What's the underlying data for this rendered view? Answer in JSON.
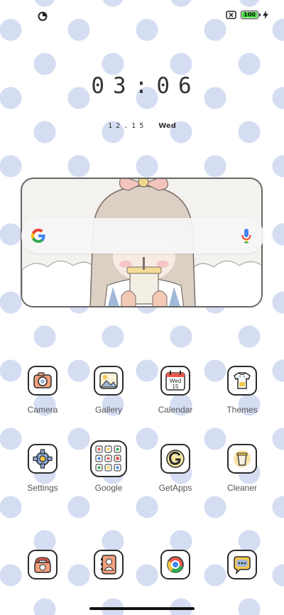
{
  "status_bar": {
    "left_icon": "data-saver-icon",
    "battery_percent": 100,
    "battery_label": "100",
    "battery_color": "#3fdc3a",
    "icons": [
      "no-sim-icon",
      "battery-icon",
      "charging-bolt-icon"
    ]
  },
  "clock": {
    "time": "03:06",
    "date_numeric": "12.15",
    "weekday": "Wed"
  },
  "search_widget": {
    "icons": [
      "google-logo-icon",
      "mic-icon"
    ]
  },
  "apps": [
    {
      "label": "Camera",
      "icon": "camera-icon"
    },
    {
      "label": "Gallery",
      "icon": "gallery-icon"
    },
    {
      "label": "Calendar",
      "icon": "calendar-icon",
      "icon_text_top": "Wed",
      "icon_text_bottom": "15"
    },
    {
      "label": "Themes",
      "icon": "themes-icon"
    },
    {
      "label": "Settings",
      "icon": "gear-icon"
    },
    {
      "label": "Google",
      "icon": "google-folder-icon"
    },
    {
      "label": "GetApps",
      "icon": "getapps-icon"
    },
    {
      "label": "Cleaner",
      "icon": "cleaner-icon"
    }
  ],
  "dock": [
    {
      "icon": "phone-icon"
    },
    {
      "icon": "contacts-icon"
    },
    {
      "icon": "chrome-icon"
    },
    {
      "icon": "messages-icon"
    }
  ],
  "colors": {
    "background": "#ffffff",
    "polka_dot": "#d5ddf2",
    "icon_outline": "#2b2b2b",
    "label": "#555555"
  },
  "pager": {
    "pages": 1,
    "current": 1
  }
}
